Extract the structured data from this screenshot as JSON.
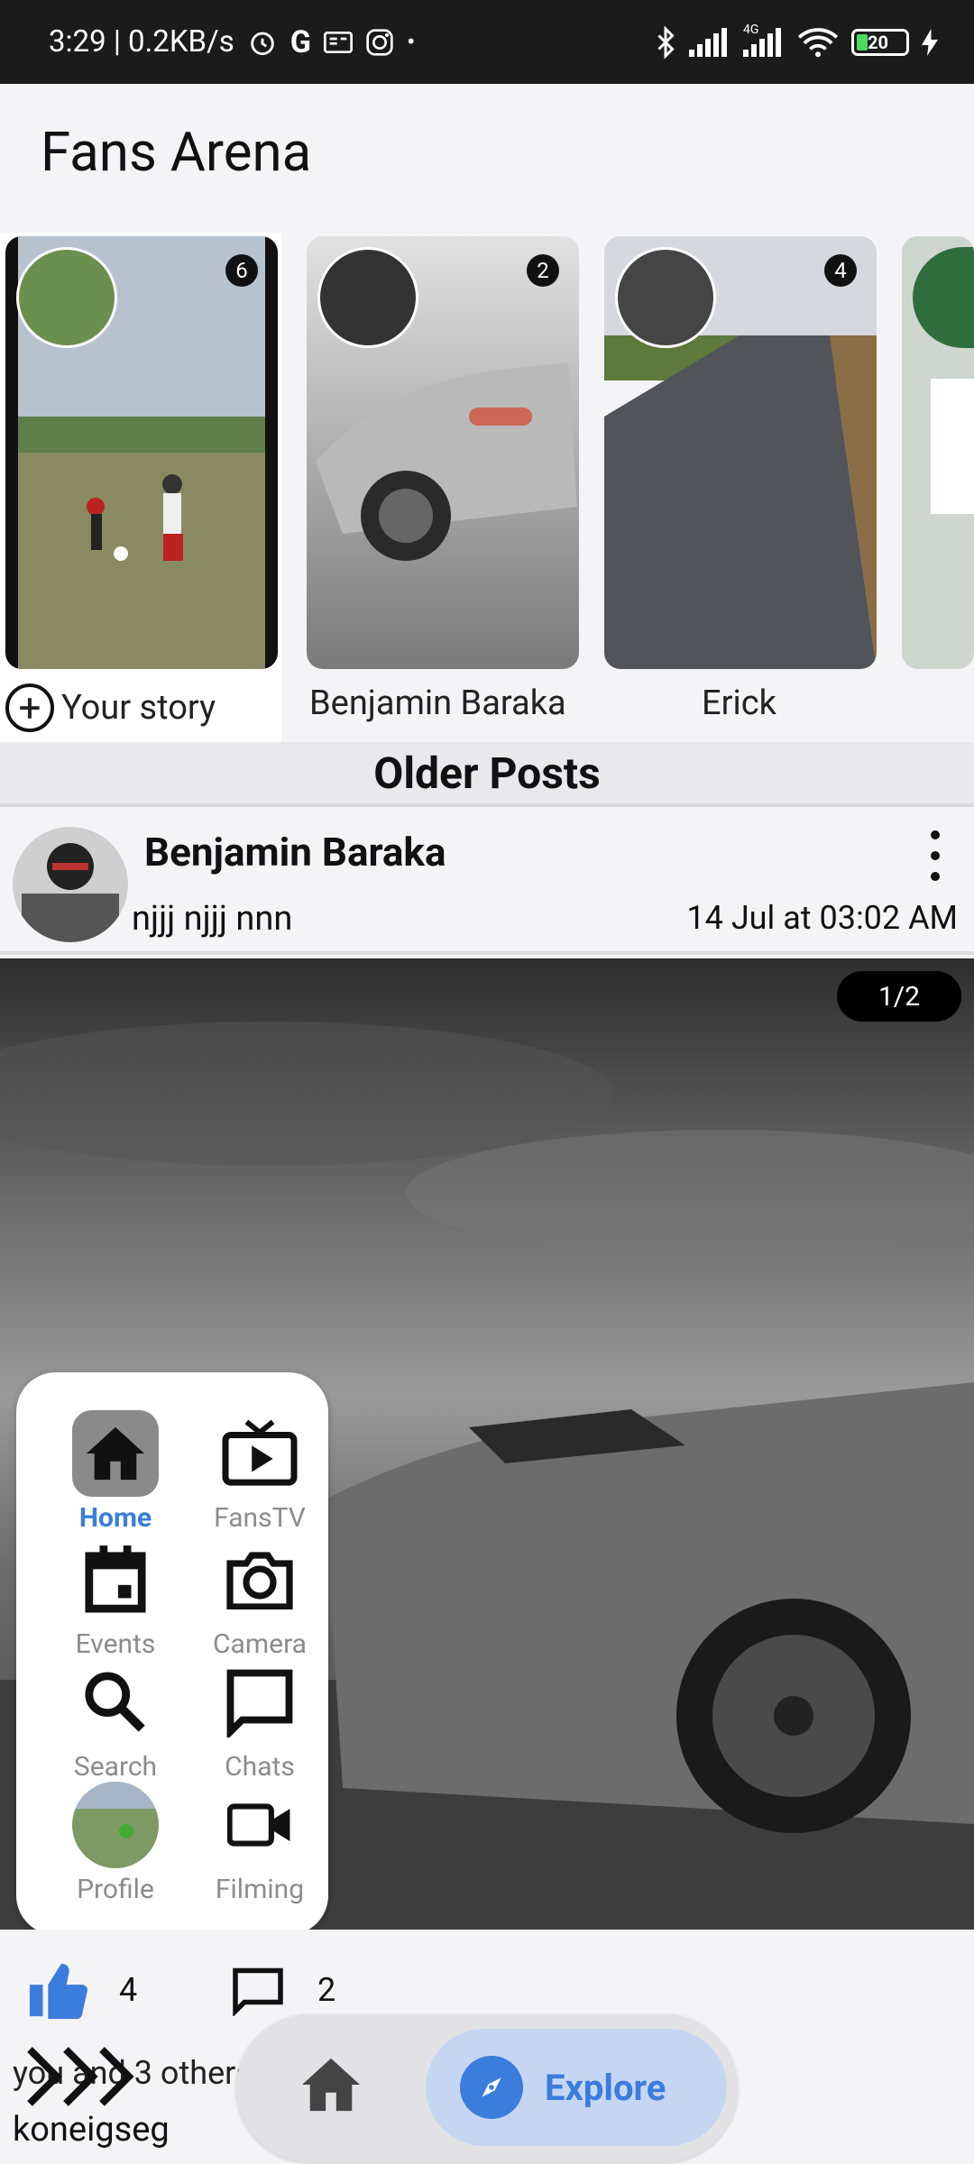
{
  "status_bar": {
    "time_speed": "3:29 | 0.2KB/s",
    "network": "4G",
    "battery": "20"
  },
  "app": {
    "title": "Fans Arena"
  },
  "stories": [
    {
      "name": "Your story",
      "count": "6",
      "add_icon": "+"
    },
    {
      "name": "Benjamin Baraka",
      "count": "2"
    },
    {
      "name": "Erick",
      "count": "4"
    },
    {
      "name": "",
      "count": ""
    }
  ],
  "section": {
    "older_posts": "Older Posts"
  },
  "post": {
    "author": "Benjamin Baraka",
    "caption": "njjj njjj nnn",
    "date": "14 Jul  at 03:02 AM",
    "image_counter": "1/2",
    "likes": "4",
    "comments": "2",
    "likes_text": "you and 3 others",
    "title": "koneigseg"
  },
  "nav_panel": {
    "items": [
      {
        "label": "Home",
        "icon": "home-icon",
        "active": true
      },
      {
        "label": "FansTV",
        "icon": "tv-icon"
      },
      {
        "label": "Events",
        "icon": "calendar-icon"
      },
      {
        "label": "Camera",
        "icon": "camera-icon"
      },
      {
        "label": "Search",
        "icon": "search-icon"
      },
      {
        "label": "Chats",
        "icon": "chat-icon"
      },
      {
        "label": "Profile",
        "icon": "profile-avatar"
      },
      {
        "label": "Filming",
        "icon": "video-camera-icon"
      }
    ]
  },
  "bottom_bar": {
    "explore_label": "Explore"
  },
  "colors": {
    "accent": "#3b7ddd",
    "status_bg": "#1b1b1b",
    "explore_bg": "#c6d6f2"
  }
}
